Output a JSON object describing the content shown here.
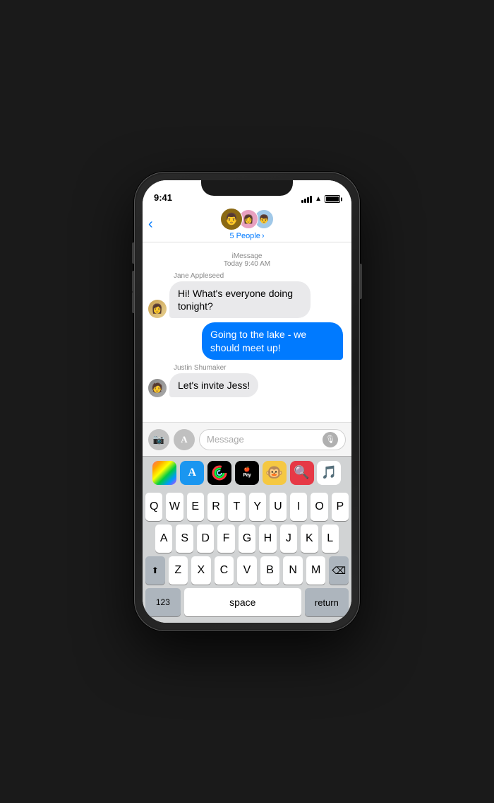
{
  "status_bar": {
    "time": "9:41",
    "battery_label": "battery"
  },
  "nav": {
    "back_label": "",
    "group_name": "5 People",
    "group_chevron": "›"
  },
  "messages": {
    "timestamp": "iMessage\nToday 9:40 AM",
    "sender1": "Jane Appleseed",
    "msg1": "Hi! What's everyone doing tonight?",
    "msg2": "Going to the lake - we should meet up!",
    "sender2": "Justin Shumaker",
    "msg3": "Let's invite Jess!"
  },
  "input": {
    "placeholder": "Message",
    "camera_icon": "📷",
    "appstore_icon": "A"
  },
  "app_strip": {
    "apps": [
      "photos",
      "appstore",
      "activity",
      "pay",
      "monkey",
      "globe",
      "music"
    ]
  },
  "keyboard": {
    "row1": [
      "Q",
      "W",
      "E",
      "R",
      "T",
      "Y",
      "U",
      "I",
      "O",
      "P"
    ],
    "row2": [
      "A",
      "S",
      "D",
      "F",
      "G",
      "H",
      "J",
      "K",
      "L"
    ],
    "row3": [
      "Z",
      "X",
      "C",
      "V",
      "B",
      "N",
      "M"
    ],
    "special_123": "123",
    "special_space": "space",
    "special_return": "return"
  }
}
